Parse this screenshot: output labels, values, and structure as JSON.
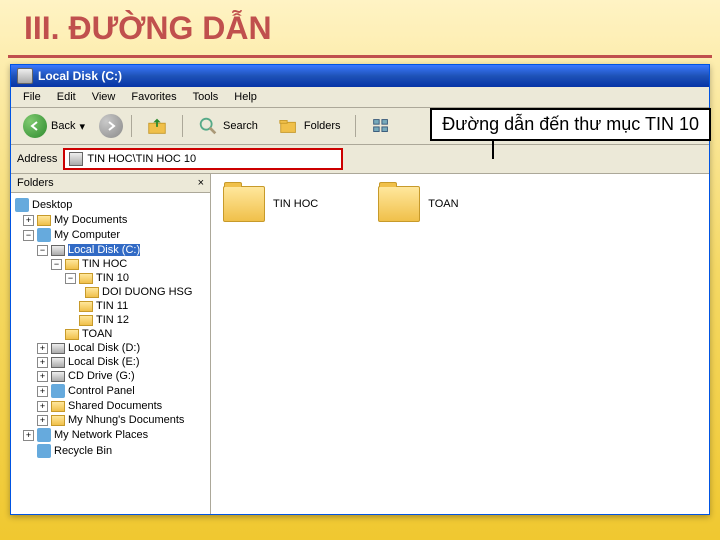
{
  "slide": {
    "title": "III. ĐƯỜNG DẪN"
  },
  "window": {
    "title": "Local Disk (C:)"
  },
  "menu": {
    "file": "File",
    "edit": "Edit",
    "view": "View",
    "favorites": "Favorites",
    "tools": "Tools",
    "help": "Help"
  },
  "toolbar": {
    "back": "Back",
    "search": "Search",
    "folders": "Folders"
  },
  "callout": {
    "text": "Đường dẫn đến thư mục TIN 10"
  },
  "address": {
    "label": "Address",
    "value": "TIN HOC\\TIN HOC 10"
  },
  "panes": {
    "foldersHeader": "Folders",
    "close": "×"
  },
  "tree": {
    "desktop": "Desktop",
    "mydocs": "My Documents",
    "mycomp": "My Computer",
    "c": "Local Disk (C:)",
    "tinhoc": "TIN HOC",
    "tin10": "TIN 10",
    "doiduong": "DOI DUONG HSG",
    "tin11": "TIN 11",
    "tin12": "TIN 12",
    "toan": "TOAN",
    "d": "Local Disk (D:)",
    "e": "Local Disk (E:)",
    "g": "CD Drive (G:)",
    "cp": "Control Panel",
    "shared": "Shared Documents",
    "nhung": "My Nhung's Documents",
    "netp": "My Network Places",
    "recycle": "Recycle Bin"
  },
  "content": {
    "f1": "TIN HOC",
    "f2": "TOAN"
  }
}
